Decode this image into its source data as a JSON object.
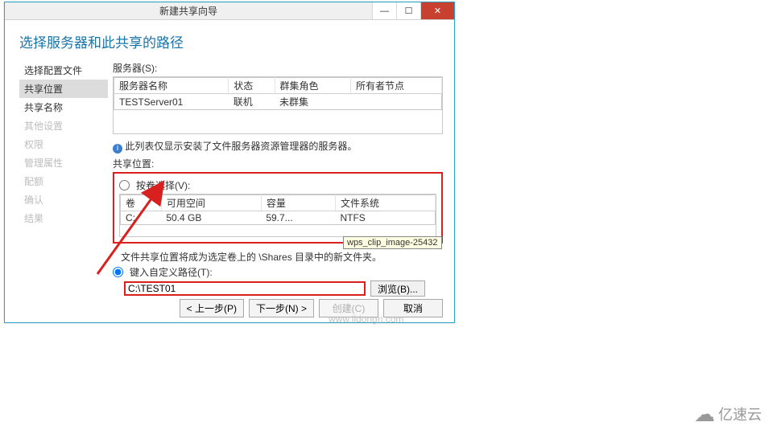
{
  "titlebar": {
    "title": "新建共享向导",
    "minimize": "—",
    "maximize": "☐",
    "close": "✕"
  },
  "header": {
    "text": "选择服务器和此共享的路径"
  },
  "sidebar": {
    "items": [
      {
        "label": "选择配置文件",
        "active": false,
        "dim": false
      },
      {
        "label": "共享位置",
        "active": true,
        "dim": false
      },
      {
        "label": "共享名称",
        "active": false,
        "dim": false
      },
      {
        "label": "其他设置",
        "active": false,
        "dim": true
      },
      {
        "label": "权限",
        "active": false,
        "dim": true
      },
      {
        "label": "管理属性",
        "active": false,
        "dim": true
      },
      {
        "label": "配额",
        "active": false,
        "dim": true
      },
      {
        "label": "确认",
        "active": false,
        "dim": true
      },
      {
        "label": "结果",
        "active": false,
        "dim": true
      }
    ]
  },
  "servers": {
    "label": "服务器(S):",
    "cols": [
      "服务器名称",
      "状态",
      "群集角色",
      "所有者节点"
    ],
    "rows": [
      {
        "name": "TESTServer01",
        "state": "联机",
        "role": "未群集",
        "owner": ""
      }
    ],
    "note": "此列表仅显示安装了文件服务器资源管理器的服务器。"
  },
  "share_location": {
    "legend": "共享位置:",
    "by_volume_label": "按卷选择(V):",
    "vol_cols": [
      "卷",
      "可用空间",
      "容量",
      "文件系统"
    ],
    "vol_rows": [
      {
        "vol": "C:",
        "free": "50.4 GB",
        "cap": "59.7...",
        "fs": "NTFS"
      }
    ],
    "note": "文件共享位置将成为选定卷上的 \\Shares 目录中的新文件夹。",
    "custom_label": "键入自定义路径(T):",
    "custom_path": "C:\\TEST01",
    "browse": "浏览(B)..."
  },
  "buttons": {
    "prev": "< 上一步(P)",
    "next": "下一步(N) >",
    "create": "创建(C)",
    "cancel": "取消"
  },
  "tooltip": {
    "text": "wps_clip_image-25432"
  },
  "watermarks": {
    "url": "www.ildongri.com",
    "brand": "亿速云"
  }
}
